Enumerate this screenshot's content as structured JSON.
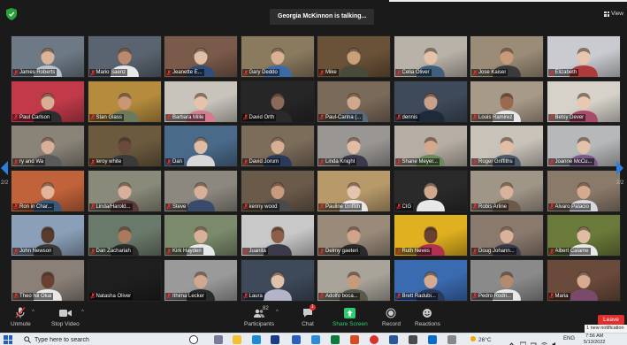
{
  "window": {
    "talking_banner": "Georgia McKinnon is talking...",
    "view_label": "View"
  },
  "pager": {
    "left_page": "2/2",
    "right_page": "2/2"
  },
  "tiles": [
    {
      "name": "James Roberts",
      "bg": "#6d7a86",
      "shirt": "#b7c2cc",
      "skin": "#d9b49a"
    },
    {
      "name": "Mario Saenz",
      "bg": "#5a6470",
      "shirt": "#e8e8e8",
      "skin": "#b98a6e"
    },
    {
      "name": "Jeanette E...",
      "bg": "#7a5a4a",
      "shirt": "#2f4f7a",
      "skin": "#e0bfa8"
    },
    {
      "name": "Gary Deddo",
      "bg": "#8a7a5e",
      "shirt": "#3c6aa8",
      "skin": "#d8b092"
    },
    {
      "name": "Mike",
      "bg": "#6a5238",
      "shirt": "#4a4a3a",
      "skin": "#caa07a"
    },
    {
      "name": "Celia Oliver",
      "bg": "#b8b2a8",
      "shirt": "#3f5f7f",
      "skin": "#e2c2a8"
    },
    {
      "name": "Jose Kaiser",
      "bg": "#9a8c76",
      "shirt": "#3a3a3a",
      "skin": "#c99a7a"
    },
    {
      "name": "Elizabeth",
      "bg": "#c9cbd0",
      "shirt": "#b03a3a",
      "skin": "#e6c6ae"
    },
    {
      "name": "Paul Carlson",
      "bg": "#c23a4a",
      "shirt": "#2e2e2e",
      "skin": "#d8ae94"
    },
    {
      "name": "Stan Glass",
      "bg": "#b58c3e",
      "shirt": "#6a7a5a",
      "skin": "#c99676"
    },
    {
      "name": "Barbara Mille",
      "bg": "#c8c4bc",
      "shirt": "#d47a8c",
      "skin": "#e6c2aa"
    },
    {
      "name": "David Orth",
      "bg": "#262626",
      "shirt": "#2a2a2a",
      "skin": "#8a6a5a"
    },
    {
      "name": "Paul-Carina (...",
      "bg": "#7a6a5a",
      "shirt": "#5a6a7a",
      "skin": "#d0a88c"
    },
    {
      "name": "dennis",
      "bg": "#3e4a5a",
      "shirt": "#1e2a3a",
      "skin": "#c9a08a"
    },
    {
      "name": "Louis Ramirez",
      "bg": "#a89a88",
      "shirt": "#e8e8e8",
      "skin": "#9a6a4e"
    },
    {
      "name": "Betsy Dever",
      "bg": "#d6d2ca",
      "shirt": "#a84a6a",
      "skin": "#e8c8b0"
    },
    {
      "name": "ry and Wa",
      "bg": "#8a8478",
      "shirt": "#5a5a5a",
      "skin": "#d6b09a"
    },
    {
      "name": "leroy white",
      "bg": "#6b5a3e",
      "shirt": "#3a3a3a",
      "skin": "#6a4a3a"
    },
    {
      "name": "Dan",
      "bg": "#4a6a8a",
      "shirt": "#d8d8d8",
      "skin": "#e0bca4"
    },
    {
      "name": "David Jorum",
      "bg": "#7c6c5a",
      "shirt": "#2a3a5a",
      "skin": "#d6ae94"
    },
    {
      "name": "Linda Knight",
      "bg": "#9a9694",
      "shirt": "#3a3a4a",
      "skin": "#e0bca6"
    },
    {
      "name": "Shane Meyer...",
      "bg": "#b6aea4",
      "shirt": "#6a8a5a",
      "skin": "#d2a88e"
    },
    {
      "name": "Roger Griffiths",
      "bg": "#c8c2b8",
      "shirt": "#4a5a6a",
      "skin": "#e0bea6"
    },
    {
      "name": "Joanne McCu...",
      "bg": "#b6b8ba",
      "shirt": "#7a5a8a",
      "skin": "#e2c2aa"
    },
    {
      "name": "Ron in Char...",
      "bg": "#c0623a",
      "shirt": "#3a5a7a",
      "skin": "#e2b49a"
    },
    {
      "name": "Linda/Harold...",
      "bg": "#8a8a7a",
      "shirt": "#5a3a3a",
      "skin": "#d6b09a"
    },
    {
      "name": "Steve",
      "bg": "#8c8880",
      "shirt": "#3a4a6a",
      "skin": "#d8b09a"
    },
    {
      "name": "kenny wood",
      "bg": "#6a5a4a",
      "shirt": "#4a4a4a",
      "skin": "#c89a7e"
    },
    {
      "name": "Pauline Griffith",
      "bg": "#b89a6a",
      "shirt": "#e8e8e8",
      "skin": "#e4c4ac"
    },
    {
      "name": "CIG",
      "bg": "#2a2a2a",
      "shirt": "#e8e8e8",
      "skin": "#d0a88e"
    },
    {
      "name": "Robis Arline",
      "bg": "#a09688",
      "shirt": "#6a5a4a",
      "skin": "#d8b29a"
    },
    {
      "name": "Alvaro Palacio",
      "bg": "#8a7a6a",
      "shirt": "#d8d8e0",
      "skin": "#d6aa8e"
    },
    {
      "name": "John Newson",
      "bg": "#8aa0b8",
      "shirt": "#3a3a3a",
      "skin": "#5a3a2a"
    },
    {
      "name": "Dan Zachariah",
      "bg": "#6a7a6a",
      "shirt": "#2a2a2a",
      "skin": "#a87a5e"
    },
    {
      "name": "Kirk Hayden",
      "bg": "#7a8a6a",
      "shirt": "#e8e8e8",
      "skin": "#d8b09a"
    },
    {
      "name": "Juanita",
      "bg": "#c8c8c8",
      "shirt": "#3a3a4a",
      "skin": "#8a5e48"
    },
    {
      "name": "Delmy gaeteri",
      "bg": "#9a8a7a",
      "shirt": "#2a2a2a",
      "skin": "#d0a488"
    },
    {
      "name": "Ruth Neves",
      "bg": "#e0b020",
      "shirt": "#b03050",
      "skin": "#6a4030"
    },
    {
      "name": "Doug Johann...",
      "bg": "#8a7a6e",
      "shirt": "#3a3a4a",
      "skin": "#d8b29a"
    },
    {
      "name": "Albert Calame",
      "bg": "#6a7a3a",
      "shirt": "#e8e8e8",
      "skin": "#e0bca4"
    },
    {
      "name": "Theo Nii Okai",
      "bg": "#8a8078",
      "shirt": "#e8e8e8",
      "skin": "#6a4030"
    },
    {
      "name": "Natasha Oliver",
      "bg": "#1e1e1e",
      "shirt": "#1e1e1e",
      "skin": "#1e1e1e"
    },
    {
      "name": "Ithima Lecker",
      "bg": "#9a9a9a",
      "shirt": "#2a2a2a",
      "skin": "#d0a890"
    },
    {
      "name": "Laura",
      "bg": "#3e4a5a",
      "shirt": "#b4b4c8",
      "skin": "#e0c2aa"
    },
    {
      "name": "Adolfo boca...",
      "bg": "#a8a49a",
      "shirt": "#5a5a4a",
      "skin": "#c89a7c"
    },
    {
      "name": "Brett Radubi...",
      "bg": "#3a6ab0",
      "shirt": "#2a3a5a",
      "skin": "#d6aa90"
    },
    {
      "name": "Pedro Rodri...",
      "bg": "#8a8a8a",
      "shirt": "#e8e8e8",
      "skin": "#b48a6e"
    },
    {
      "name": "Maria",
      "bg": "#6a4a3a",
      "shirt": "#7a4a6a",
      "skin": "#d6aa90"
    }
  ],
  "toolbar": {
    "unmute": "Unmute",
    "stop_video": "Stop Video",
    "participants": "Participants",
    "participant_count": "82",
    "chat": "Chat",
    "chat_badge": "1",
    "share_screen": "Share Screen",
    "record": "Record",
    "reactions": "Reactions",
    "leave": "Leave",
    "notification": "1 new notification"
  },
  "taskbar": {
    "search_placeholder": "Type here to search",
    "weather": "26°C",
    "lang": "ENG",
    "time": "7:56 AM",
    "date": "5/13/2022"
  },
  "colors": {
    "accent": "#2b7fe0",
    "share_green": "#2ecc71",
    "leave_red": "#e02f2f",
    "mute_red": "#e02f2f"
  }
}
